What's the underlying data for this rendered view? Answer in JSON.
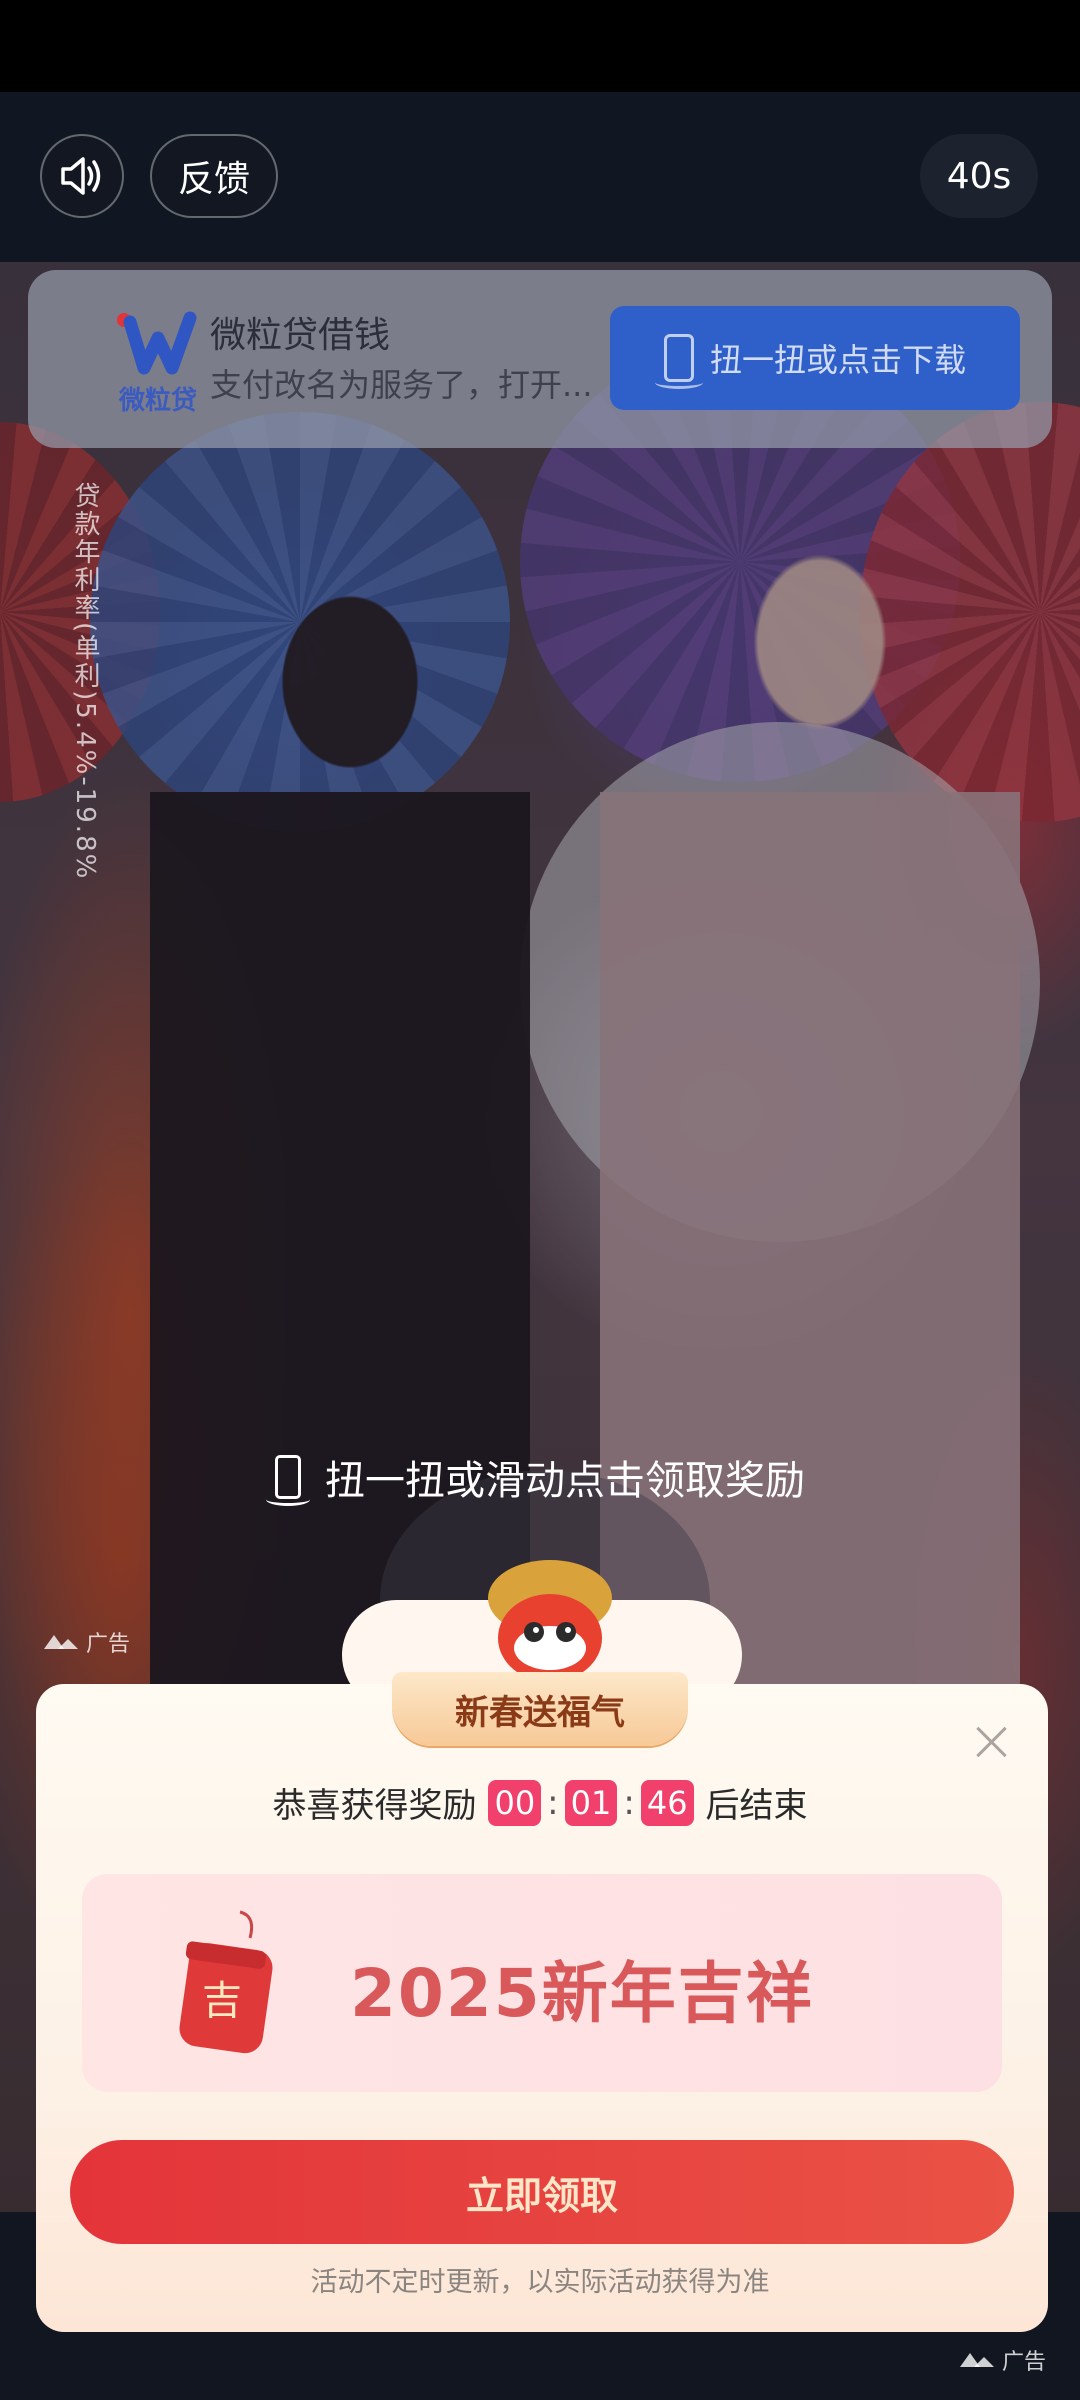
{
  "header": {
    "feedback_label": "反馈",
    "countdown": "40s"
  },
  "icons": {
    "sound": "speaker-icon",
    "download_phone": "phone-shake-icon",
    "close": "close-icon",
    "ad_mark": "mountain-icon"
  },
  "ad_card": {
    "logo_text": "微粒贷",
    "title": "微粒贷借钱",
    "description": "支付改名为服务了，打开...",
    "download_label": "扭一扭或点击下载"
  },
  "video": {
    "vertical_disclaimer": "贷款年利率(单利)5.4%-19.8%",
    "shake_hint": "扭一扭或滑动点击领取奖励",
    "ad_label": "广告"
  },
  "popup": {
    "ribbon_title": "新春送福气",
    "reward_prefix": "恭喜获得奖励",
    "countdown": {
      "hours": "00",
      "minutes": "01",
      "seconds": "46"
    },
    "reward_suffix": "后结束",
    "pouch_char": "吉",
    "prize_title": "2025新年吉祥",
    "claim_label": "立即领取",
    "footnote": "活动不定时更新，以实际活动获得为准"
  },
  "bottom": {
    "ad_label": "广告"
  },
  "colors": {
    "accent_red": "#e3343a",
    "download_blue": "#2f5fc9",
    "countdown_pink": "#f0406b",
    "prize_text": "#d9595b"
  }
}
